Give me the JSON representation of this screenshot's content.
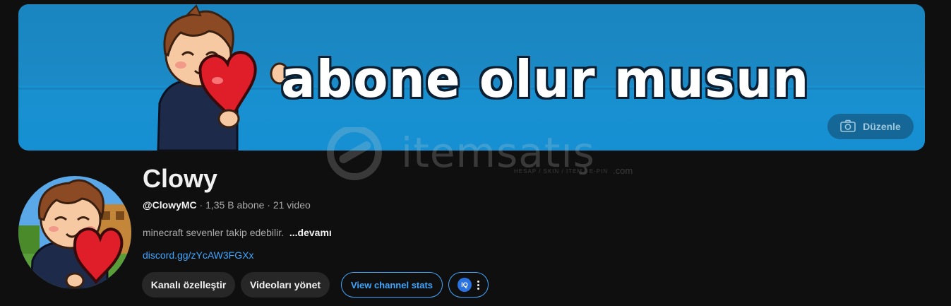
{
  "banner": {
    "text": "abone olur musun",
    "edit_label": "Düzenle"
  },
  "watermark": {
    "brand": "itemsatış",
    "tagline": "HESAP / SKIN / ITEM / E-PIN",
    "tld": ".com"
  },
  "channel": {
    "name": "Clowy",
    "handle": "@ClowyMC",
    "stats": " · 1,35 B abone · 21 video",
    "description": "minecraft sevenler takip edebilir.",
    "more_label": "...devamı",
    "link": "discord.gg/zYcAW3FGXx"
  },
  "actions": {
    "customize_label": "Kanalı özelleştir",
    "manage_label": "Videoları yönet",
    "stats_label": "View channel stats",
    "extension_badge": "IQ"
  },
  "colors": {
    "background": "#0f0f0f",
    "banner_blue": "#1b8ac6",
    "link_blue": "#3ea6ff",
    "button_dark": "#272727"
  }
}
